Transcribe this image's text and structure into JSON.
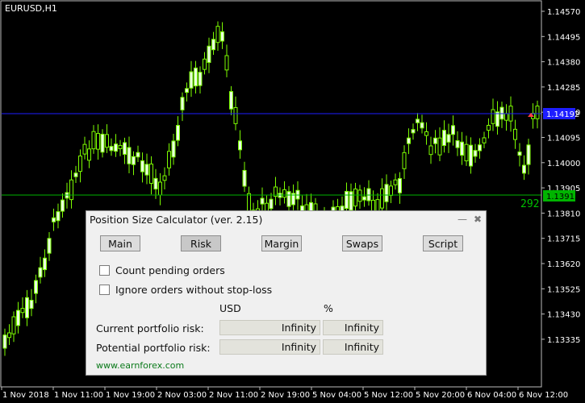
{
  "chart": {
    "symbol_label": "EURUSD,H1",
    "price_labels": [
      "1.14570",
      "1.14495",
      "1.14380",
      "1.14285",
      "1.14190",
      "1.14095",
      "1.14000",
      "1.13905",
      "1.13810",
      "1.13715",
      "1.13620",
      "1.13525",
      "1.13430",
      "1.13335"
    ],
    "time_labels": [
      "1 Nov 2018",
      "1 Nov 11:00",
      "1 Nov 19:00",
      "2 Nov 03:00",
      "2 Nov 11:00",
      "2 Nov 19:00",
      "5 Nov 04:00",
      "5 Nov 12:00",
      "5 Nov 20:00",
      "6 Nov 04:00",
      "6 Nov 12:00"
    ],
    "entry_line_label": "1.14192",
    "stop_line_label": "1.13913",
    "stop_points": "292",
    "colors": {
      "background": "#000000",
      "candles": "#7CFC00",
      "entry_line": "#0000FF",
      "stop_line": "#00C000",
      "axis_text": "#FFFFFF"
    }
  },
  "panel": {
    "title": "Position Size Calculator (ver. 2.15)",
    "minimize_icon": "minimize-icon",
    "close_icon": "close-icon",
    "tabs": [
      "Main",
      "Risk",
      "Margin",
      "Swaps",
      "Script"
    ],
    "active_tab": "Risk",
    "count_pending_label": "Count pending orders",
    "ignore_no_sl_label": "Ignore orders without stop-loss",
    "col_currency": "USD",
    "col_percent": "%",
    "current_risk_label": "Current portfolio risk:",
    "current_risk_usd": "Infinity",
    "current_risk_pct": "Infinity",
    "potential_risk_label": "Potential portfolio risk:",
    "potential_risk_usd": "Infinity",
    "potential_risk_pct": "Infinity",
    "link": "www.earnforex.com"
  }
}
